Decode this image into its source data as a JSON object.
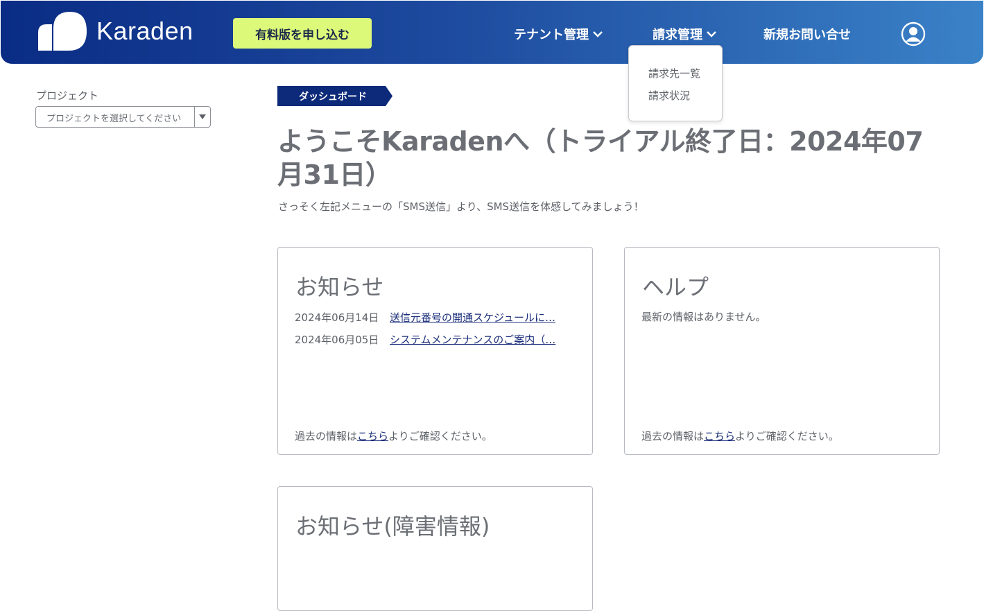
{
  "header": {
    "logo_text": "Karaden",
    "upgrade_button": "有料版を申し込む",
    "nav": {
      "tenant": "テナント管理",
      "billing": "請求管理",
      "contact": "新規お問い合せ"
    }
  },
  "billing_menu": {
    "items": [
      "請求先一覧",
      "請求状況"
    ]
  },
  "sidebar": {
    "project_label": "プロジェクト",
    "project_placeholder": "プロジェクトを選択してください"
  },
  "breadcrumb": "ダッシュボード",
  "welcome": {
    "title": "ようこそKaradenへ（トライアル終了日：2024年07月31日）",
    "subtitle": "さっそく左記メニューの「SMS送信」より、SMS送信を体感してみましょう！"
  },
  "cards": {
    "news": {
      "title": "お知らせ",
      "items": [
        {
          "date": "2024年06月14日",
          "text": "送信元番号の開通スケジュールに…"
        },
        {
          "date": "2024年06月05日",
          "text": "システムメンテナンスのご案内（…"
        }
      ],
      "footer_prefix": "過去の情報は",
      "footer_link": "こちら",
      "footer_suffix": "よりご確認ください。"
    },
    "help": {
      "title": "ヘルプ",
      "empty": "最新の情報はありません。",
      "footer_prefix": "過去の情報は",
      "footer_link": "こちら",
      "footer_suffix": "よりご確認ください。"
    },
    "outage": {
      "title": "お知らせ(障害情報)"
    }
  },
  "colors": {
    "header_start": "#0a2c84",
    "header_end": "#3a82c8",
    "upgrade_bg": "#ddf97a",
    "link": "#1a2d7a",
    "ribbon": "#0d2a7a"
  },
  "icons": {
    "logo": "karaden-logo-icon",
    "chevron": "chevron-down-icon",
    "user": "user-account-icon",
    "select_arrow": "caret-down-icon"
  }
}
